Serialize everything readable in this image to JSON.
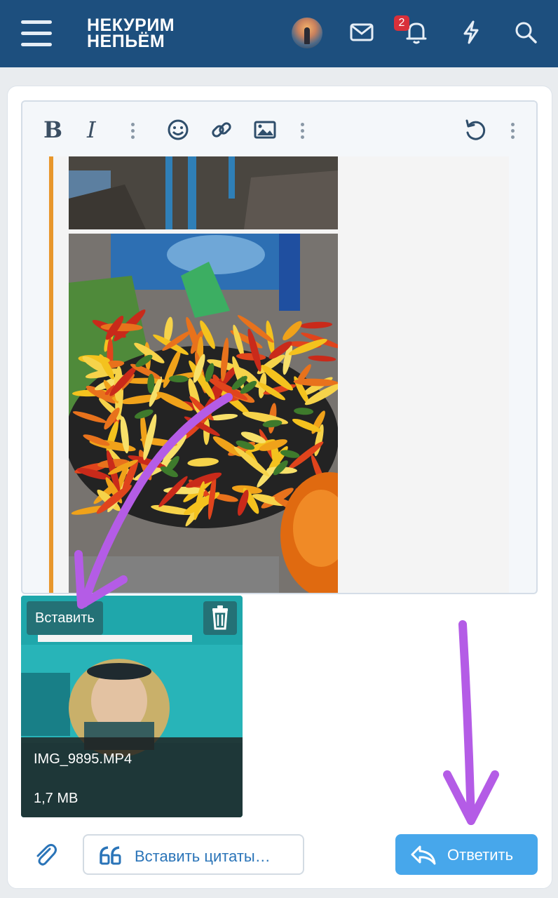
{
  "header": {
    "logo_line1": "НЕКУРИМ",
    "logo_line2": "НЕПЬЁМ",
    "notifications_count": "2",
    "colors": {
      "bar": "#1d4f7e",
      "badge": "#d9303a"
    }
  },
  "editor": {
    "toolbar": {
      "bold_label": "B",
      "italic_label": "I",
      "icons": [
        "more-icon",
        "emoji-icon",
        "link-icon",
        "image-icon",
        "more-icon",
        "undo-icon",
        "more-icon"
      ]
    },
    "quote_bar_color": "#e8962a"
  },
  "attachment": {
    "insert_label": "Вставить",
    "file_name": "IMG_9895.MP4",
    "file_size": "1,7 MB"
  },
  "actions": {
    "insert_quotes_label": "Вставить цитаты…",
    "reply_label": "Ответить",
    "reply_color": "#47a7eb"
  },
  "annotation_color": "#b45ce6"
}
